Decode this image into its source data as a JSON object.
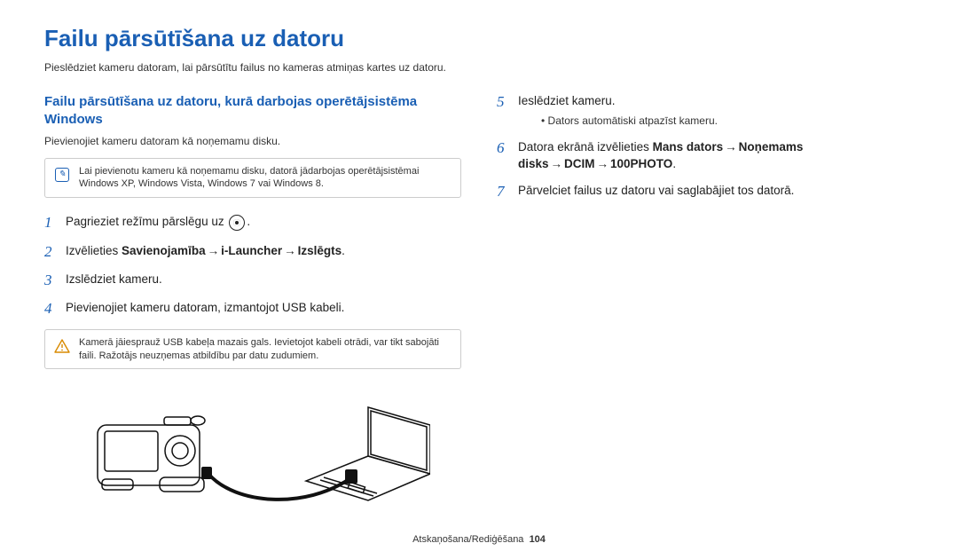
{
  "title": "Failu pārsūtīšana uz datoru",
  "intro": "Pieslēdziet kameru datoram, lai pārsūtītu failus no kameras atmiņas kartes uz datoru.",
  "left": {
    "heading": "Failu pārsūtīšana uz datoru, kurā darbojas operētājsistēma Windows",
    "subtext": "Pievienojiet kameru datoram kā noņemamu disku.",
    "note_info": "Lai pievienotu kameru kā noņemamu disku, datorā jādarbojas operētājsistēmai Windows XP, Windows Vista, Windows 7 vai Windows 8.",
    "step1_a": "Pagrieziet režīmu pārslēgu uz ",
    "step1_b": ".",
    "step2_a": "Izvēlieties ",
    "step2_b1": "Savienojamība",
    "step2_b2": "i-Launcher",
    "step2_b3": "Izslēgts",
    "step2_c": ".",
    "step3": "Izslēdziet kameru.",
    "step4": "Pievienojiet kameru datoram, izmantojot USB kabeli.",
    "note_warn": "Kamerā jāiesprauž USB kabeļa mazais gals. Ievietojot kabeli otrādi, var tikt sabojāti faili. Ražotājs neuzņemas atbildību par datu zudumiem."
  },
  "right": {
    "step5": "Ieslēdziet kameru.",
    "step5_bullet": "Dators automātiski atpazīst kameru.",
    "step6_a": "Datora ekrānā izvēlieties ",
    "step6_b1": "Mans dators",
    "step6_b2": "Noņemams disks",
    "step6_b3": "DCIM",
    "step6_b4": "100PHOTO",
    "step6_c": ".",
    "step7": "Pārvelciet failus uz datoru vai saglabājiet tos datorā."
  },
  "nums": {
    "n1": "1",
    "n2": "2",
    "n3": "3",
    "n4": "4",
    "n5": "5",
    "n6": "6",
    "n7": "7"
  },
  "arrow": "→",
  "footer_section": "Atskaņošana/Rediģēšana",
  "footer_page": "104"
}
